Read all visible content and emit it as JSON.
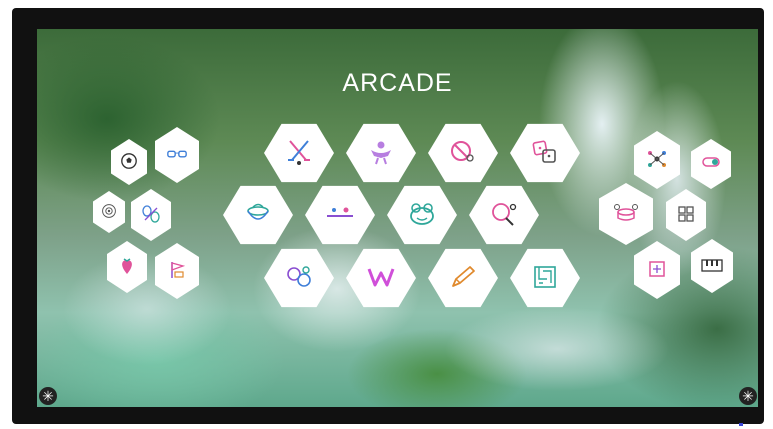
{
  "title": "ARCADE",
  "apps": [
    {
      "label": "",
      "icon": "soccer-ball-icon"
    },
    {
      "label": "",
      "icon": "sunglasses-icon"
    },
    {
      "label": "",
      "icon": "target-icon"
    },
    {
      "label": "",
      "icon": "butterfly-icon"
    },
    {
      "label": "",
      "icon": "strawberry-icon"
    },
    {
      "label": "",
      "icon": "flag-icon"
    },
    {
      "label": "",
      "icon": "hockey-sticks-icon"
    },
    {
      "label": "",
      "icon": "figure-icon"
    },
    {
      "label": "",
      "icon": "no-sign-icon"
    },
    {
      "label": "",
      "icon": "dice-icon"
    },
    {
      "label": "",
      "icon": "bowl-icon"
    },
    {
      "label": "",
      "icon": "pool-cue-icon"
    },
    {
      "label": "",
      "icon": "frog-icon"
    },
    {
      "label": "",
      "icon": "ping-pong-icon"
    },
    {
      "label": "",
      "icon": "bubbles-icon"
    },
    {
      "label": "",
      "icon": "letter-w-icon"
    },
    {
      "label": "",
      "icon": "pencil-icon"
    },
    {
      "label": "",
      "icon": "maze-icon"
    },
    {
      "label": "",
      "icon": "molecule-icon"
    },
    {
      "label": "",
      "icon": "toggle-icon"
    },
    {
      "label": "",
      "icon": "drums-icon"
    },
    {
      "label": "",
      "icon": "grid-icon"
    },
    {
      "label": "",
      "icon": "map-icon"
    },
    {
      "label": "",
      "icon": "piano-icon"
    }
  ],
  "colors": {
    "icon_pink": "#e0539a",
    "icon_purple": "#8a4fd1",
    "icon_teal": "#2fa79a",
    "icon_blue": "#3f7fd8",
    "icon_orange": "#e08a2e"
  }
}
